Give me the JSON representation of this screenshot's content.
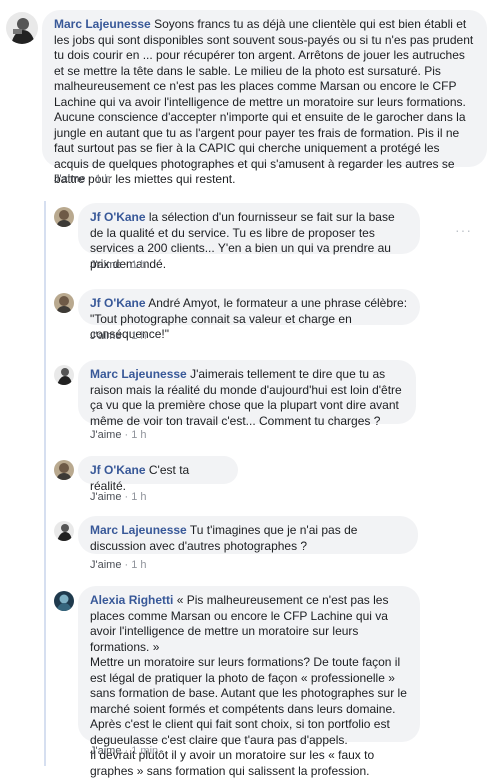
{
  "like_label": "J'aime",
  "sep": "·",
  "comments": [
    {
      "author": "Marc Lajeunesse",
      "avatar_icon": "user-avatar-marc",
      "text": "Soyons francs tu as déjà une clientèle qui est bien établi et les jobs qui sont disponibles sont souvent sous-payés ou si tu n'es pas prudent tu dois courir en ... pour récupérer ton argent. Arrêtons de jouer les autruches et se mettre la tête dans le sable. Le milieu de la photo est sursaturé. Pis malheureusement ce n'est pas les places comme Marsan ou encore le CFP Lachine qui va avoir l'intelligence de mettre un moratoire sur leurs formations. Aucune conscience d'accepter n'importe qui et ensuite de le garocher dans la jungle en autant que tu as l'argent pour payer tes frais de formation. Pis il ne faut surtout pas se fier à la CAPIC qui cherche uniquement a protégé les acquis de quelques photographes et qui s'amusent à regarder les autres se battre pour les miettes qui restent.",
      "time": "1 h"
    },
    {
      "author": "Jf O'Kane",
      "avatar_icon": "user-avatar-jf",
      "text": "la sélection d'un fournisseur se fait sur la base de la qualité et du service. Tu es libre de proposer tes services a 200 clients... Y'en a bien un qui va prendre au prix demandé.",
      "time": "1 h",
      "more_icon": "···"
    },
    {
      "author": "Jf O'Kane",
      "avatar_icon": "user-avatar-jf",
      "text": "André Amyot, le formateur a une phrase célèbre: \"Tout photographe connait sa valeur et charge en conséquence!\"",
      "time": "1 h"
    },
    {
      "author": "Marc Lajeunesse",
      "avatar_icon": "user-avatar-marc",
      "text": "J'aimerais tellement te dire que tu as raison mais la réalité du monde d'aujourd'hui est loin d'être ça vu que la première chose que la plupart vont dire avant même de voir ton travail c'est... Comment tu charges ?",
      "time": "1 h"
    },
    {
      "author": "Jf O'Kane",
      "avatar_icon": "user-avatar-jf",
      "text": "C'est ta réalité.",
      "time": "1 h"
    },
    {
      "author": "Marc Lajeunesse",
      "avatar_icon": "user-avatar-marc",
      "text": "Tu t'imagines que je n'ai pas de discussion avec d'autres photographes ?",
      "time": "1 h"
    },
    {
      "author": "Alexia Righetti",
      "avatar_icon": "user-avatar-alexia",
      "text": "« Pis malheureusement ce n'est pas les places comme Marsan ou encore le CFP Lachine qui va avoir l'intelligence de mettre un moratoire sur leurs formations. »\nMettre un moratoire sur leurs formations? De toute façon il est légal de pratiquer la photo de façon « professionelle » sans formation de base. Autant que les photographes sur le marché soient formés et compétents dans leurs domaine. Après c'est le client qui fait sont choix, si ton portfolio est degueulasse c'est claire que t'aura pas d'appels.\nIl devrait plutôt il y avoir un moratoire sur les « faux to graphes » sans formation qui salissent la profession.",
      "time": "1 min"
    }
  ]
}
